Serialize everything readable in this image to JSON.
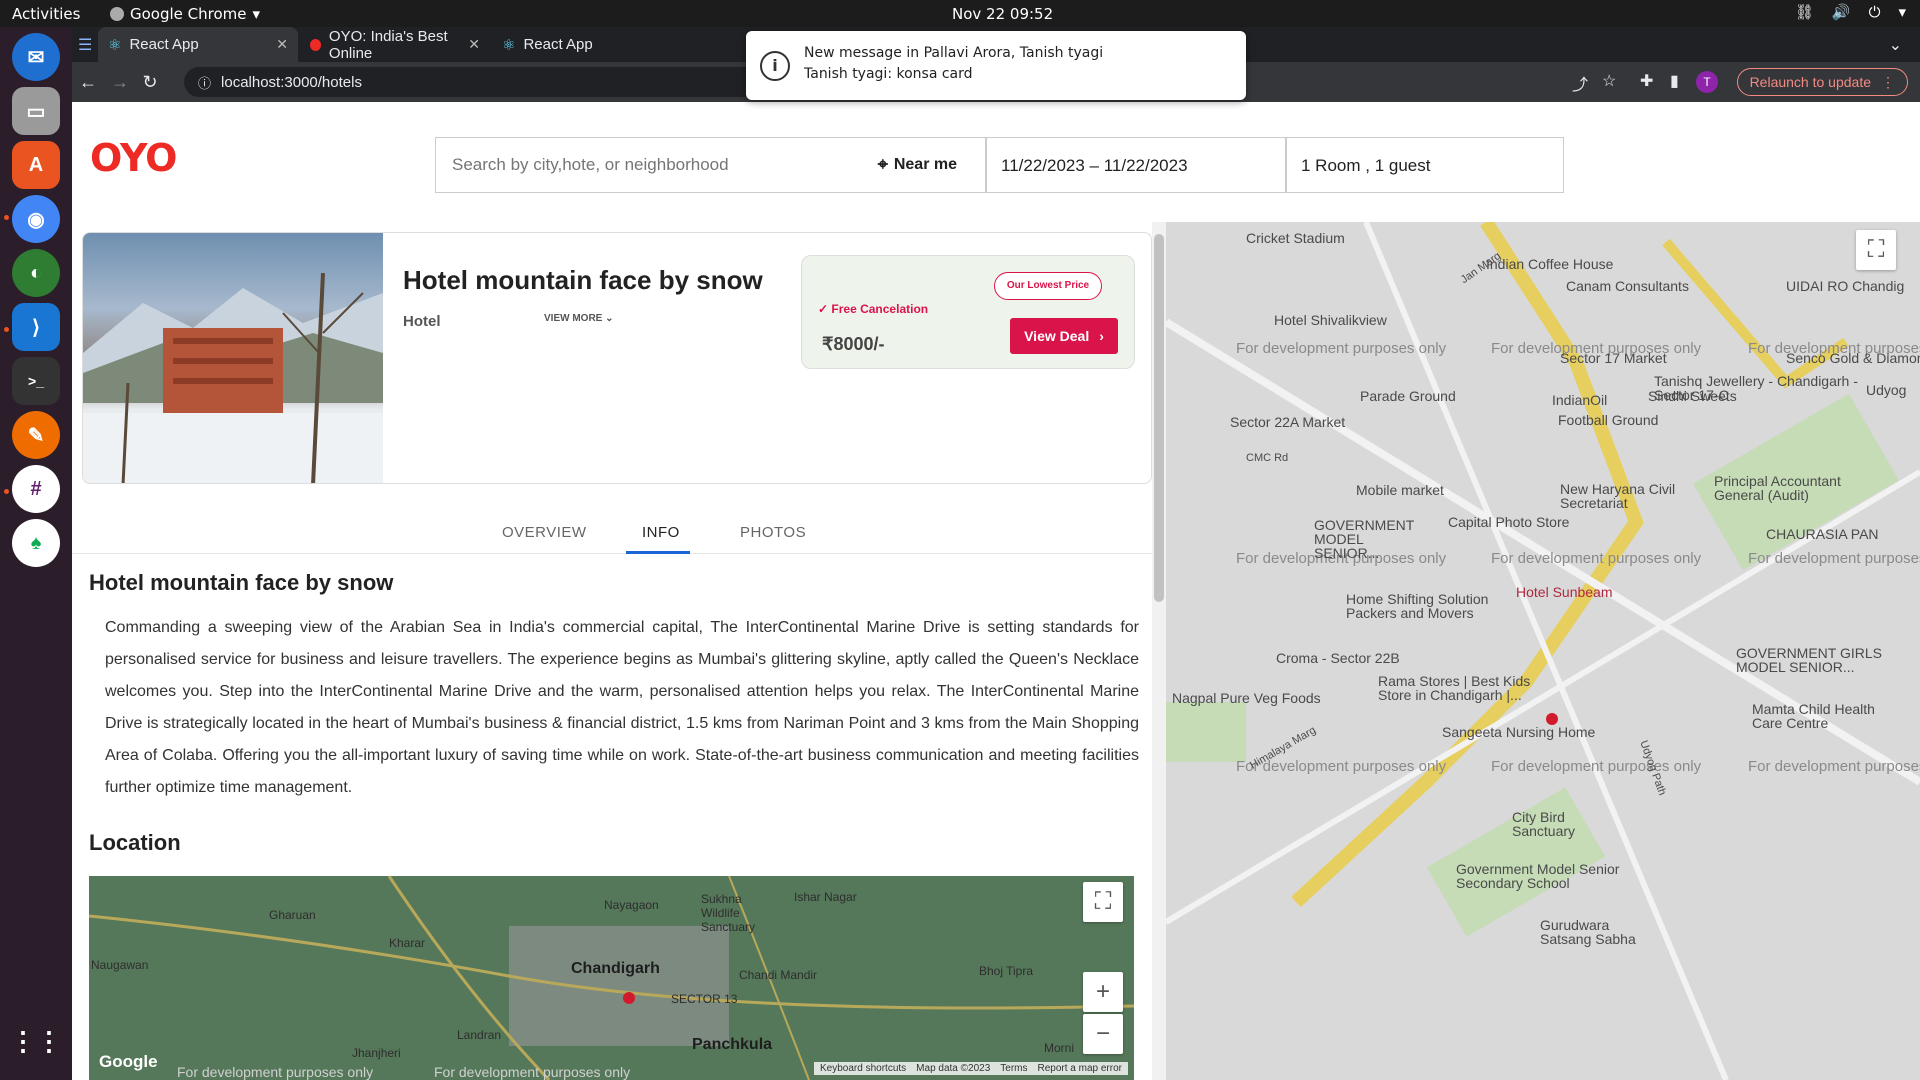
{
  "os": {
    "activities": "Activities",
    "app_name": "Google Chrome",
    "clock": "Nov 22  09:52"
  },
  "browser": {
    "tabs": [
      {
        "label": "React App"
      },
      {
        "label": "OYO: India's Best Online"
      },
      {
        "label": "React App"
      }
    ],
    "url": "localhost:3000/hotels",
    "relaunch": "Relaunch to update",
    "profile_initial": "T"
  },
  "notification": {
    "title": "New message in Pallavi Arora, Tanish tyagi",
    "body": "Tanish tyagi: konsa card"
  },
  "header": {
    "logo": "OYO",
    "search_placeholder": "Search by city,hote, or neighborhood",
    "near_me": "Near me",
    "dates": "11/22/2023 – 11/22/2023",
    "guests": "1 Room , 1 guest"
  },
  "hotel": {
    "name": "Hotel mountain face by snow",
    "type": "Hotel",
    "view_more": "VIEW MORE",
    "badge": "Our Lowest Price",
    "free_cancel": "Free Cancelation",
    "price": "₹8000/-",
    "view_deal": "View Deal"
  },
  "tabs": {
    "overview": "OVERVIEW",
    "info": "INFO",
    "photos": "PHOTOS"
  },
  "info": {
    "title": "Hotel mountain face by snow",
    "description": "Commanding a sweeping view of the Arabian Sea in India's commercial capital, The InterContinental Marine Drive is setting standards for personalised service for business and leisure travellers. The experience begins as Mumbai's glittering skyline, aptly called the Queen's Necklace welcomes you. Step into the InterContinental Marine Drive and the warm, personalised attention helps you relax. The InterContinental Marine Drive is strategically located in the heart of Mumbai's business & financial district, 1.5 kms from Nariman Point and 3 kms from the Main Shopping Area of Colaba. Offering you the all-important luxury of saving time while on work. State-of-the-art business communication and meeting facilities further optimize time management.",
    "location_title": "Location"
  },
  "minimap": {
    "labels": [
      "Gharuan",
      "Naugawan",
      "Kharar",
      "Nayagaon",
      "Sukhna Wildlife Sanctuary",
      "Ishar Nagar",
      "Chandi Mandir",
      "Bhoj Tipra",
      "Landran",
      "Jhanjheri",
      "Panchkula",
      "SECTOR 13",
      "Morni"
    ],
    "city": "Chandigarh",
    "google": "Google",
    "dev_text": "For development purposes only",
    "attrib": [
      "Keyboard shortcuts",
      "Map data ©2023",
      "Terms",
      "Report a map error"
    ]
  },
  "bigmap": {
    "dev_text": "For development purposes only",
    "places": [
      "Cricket Stadium",
      "Indian Coffee House",
      "Canam Consultants",
      "UIDAI RO Chandig",
      "Hotel Shivalikview",
      "Sector 17 Market",
      "Senco Gold & Diamon",
      "Tanishq Jewellery - Chandigarh - Sector 17-C",
      "Parade Ground",
      "Sindhi Sweets",
      "IndianOil",
      "Football Ground",
      "Udyog",
      "Sector 22A Market",
      "CMC Rd",
      "Mobile market",
      "New Haryana Civil Secretariat",
      "Principal Accountant General (Audit)",
      "GOVERNMENT MODEL SENIOR...",
      "Capital Photo Store",
      "CHAURASIA PAN",
      "Hotel Sunbeam",
      "Home Shifting Solution Packers and Movers",
      "Croma - Sector 22B",
      "Rama Stores | Best Kids Store in Chandigarh |...",
      "Nagpal Pure Veg Foods",
      "GOVERNMENT GIRLS MODEL SENIOR...",
      "Mamta Child Health Care Centre",
      "Sangeeta Nursing Home",
      "City Bird Sanctuary",
      "Government Model Senior Secondary School",
      "Gurudwara Satsang Sabha",
      "Himalaya Marg",
      "Jan Marg",
      "Udyog Path"
    ]
  },
  "colors": {
    "brand": "#ee2a24",
    "accent": "#d9144a",
    "tab_active": "#1a66d6"
  }
}
